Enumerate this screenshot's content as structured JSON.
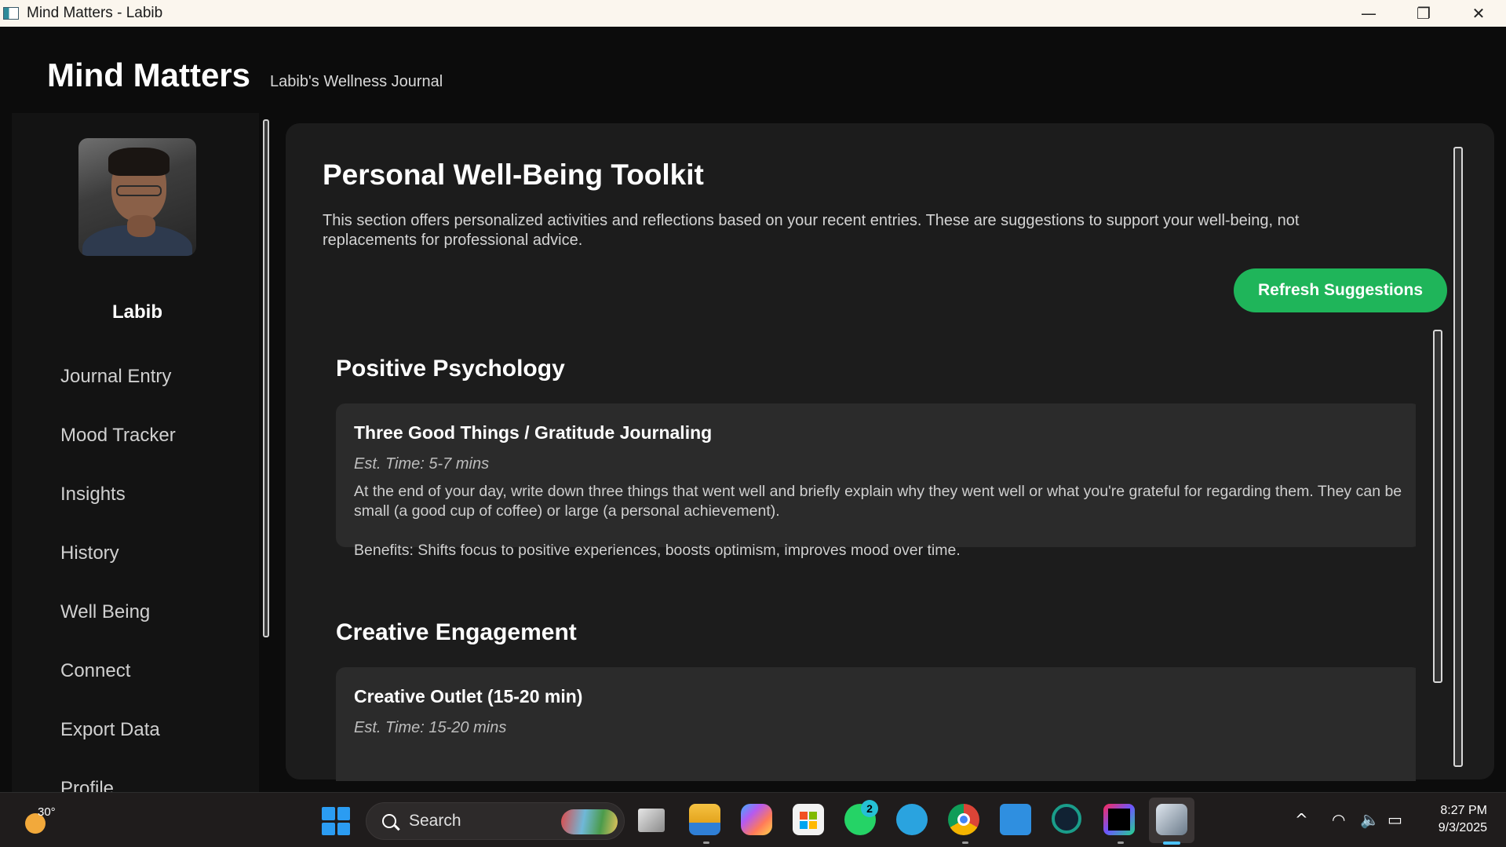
{
  "window": {
    "title": "Mind Matters - Labib",
    "minimize": "—",
    "restore": "❐",
    "close": "✕"
  },
  "header": {
    "brand": "Mind Matters",
    "subtitle": "Labib's Wellness Journal"
  },
  "sidebar": {
    "user_name": "Labib",
    "items": [
      {
        "label": "Journal Entry"
      },
      {
        "label": "Mood Tracker"
      },
      {
        "label": "Insights"
      },
      {
        "label": "History"
      },
      {
        "label": "Well Being"
      },
      {
        "label": "Connect"
      },
      {
        "label": "Export Data"
      },
      {
        "label": "Profile"
      }
    ]
  },
  "main": {
    "title": "Personal Well-Being Toolkit",
    "description": "This section offers personalized activities and reflections based on your recent entries. These are suggestions to support your well-being, not replacements for professional advice.",
    "refresh_label": "Refresh Suggestions",
    "sections": [
      {
        "title": "Positive Psychology",
        "card": {
          "title": "Three Good Things / Gratitude Journaling",
          "time": "Est. Time: 5-7 mins",
          "description": "At the end of your day, write down three things that went well and briefly explain why they went well or what you're grateful for regarding them. They can be small (a good cup of coffee) or large (a personal achievement).",
          "benefits": "Benefits: Shifts focus to positive experiences, boosts optimism, improves mood over time."
        }
      },
      {
        "title": "Creative Engagement",
        "card": {
          "title": "Creative Outlet (15-20 min)",
          "time": "Est. Time: 15-20 mins"
        }
      }
    ]
  },
  "taskbar": {
    "weather_temp": "30°",
    "search_label": "Search",
    "whatsapp_badge": "2",
    "clock_time": "8:27 PM",
    "clock_date": "9/3/2025",
    "tray_chevron": "^",
    "icons": [
      "weather-icon",
      "start-icon",
      "search-icon",
      "task-view-icon",
      "file-explorer-icon",
      "copilot-icon",
      "store-icon",
      "whatsapp-icon",
      "telegram-icon",
      "chrome-icon",
      "vscode-icon",
      "screen-recorder-icon",
      "intellij-icon",
      "java-app-icon",
      "wifi-icon",
      "volume-icon",
      "battery-icon"
    ]
  },
  "colors": {
    "accent": "#1fb55a",
    "background": "#0c0c0c",
    "panel": "#1c1c1c",
    "card": "#2b2b2b"
  }
}
